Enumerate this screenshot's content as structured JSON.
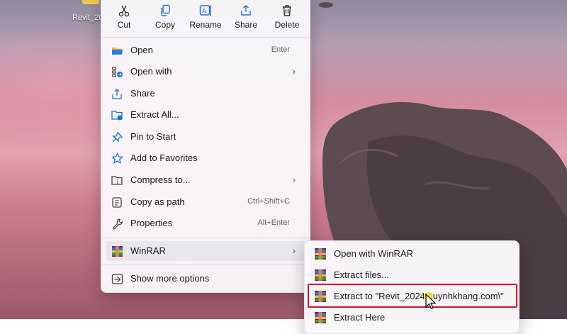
{
  "desktop": {
    "icon_label": "Revit_20"
  },
  "context_menu": {
    "toolbar": [
      {
        "label": "Cut",
        "icon": "scissors-icon"
      },
      {
        "label": "Copy",
        "icon": "copy-icon"
      },
      {
        "label": "Rename",
        "icon": "rename-icon"
      },
      {
        "label": "Share",
        "icon": "share-icon"
      },
      {
        "label": "Delete",
        "icon": "trash-icon"
      }
    ],
    "items": [
      {
        "label": "Open",
        "shortcut": "Enter",
        "icon": "folder-open-icon"
      },
      {
        "label": "Open with",
        "shortcut": "",
        "icon": "open-with-icon",
        "submenu": true
      },
      {
        "label": "Share",
        "shortcut": "",
        "icon": "share-icon"
      },
      {
        "label": "Extract All...",
        "shortcut": "",
        "icon": "extract-icon"
      },
      {
        "label": "Pin to Start",
        "shortcut": "",
        "icon": "pin-icon"
      },
      {
        "label": "Add to Favorites",
        "shortcut": "",
        "icon": "star-icon"
      },
      {
        "label": "Compress to...",
        "shortcut": "",
        "icon": "compress-icon",
        "submenu": true
      },
      {
        "label": "Copy as path",
        "shortcut": "Ctrl+Shift+C",
        "icon": "path-icon"
      },
      {
        "label": "Properties",
        "shortcut": "Alt+Enter",
        "icon": "wrench-icon"
      },
      {
        "label": "WinRAR",
        "shortcut": "",
        "icon": "winrar-icon",
        "submenu": true
      },
      {
        "label": "Show more options",
        "shortcut": "",
        "icon": "more-options-icon"
      }
    ]
  },
  "winrar_submenu": {
    "items": [
      {
        "label": "Open with WinRAR"
      },
      {
        "label": "Extract files..."
      },
      {
        "label": "Extract to \"Revit_2024 huynhkhang.com\\\""
      },
      {
        "label": "Extract Here"
      }
    ]
  },
  "colors": {
    "highlight_border": "#d3152a",
    "accent_blue": "#1f6fd1"
  }
}
